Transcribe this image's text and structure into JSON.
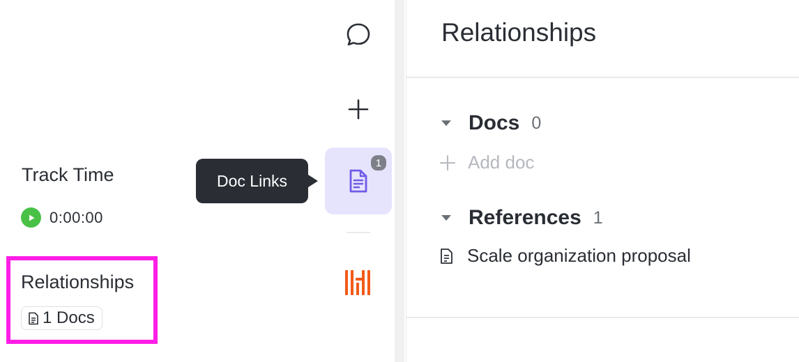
{
  "left_panel": {
    "track_time": {
      "title": "Track Time",
      "value": "0:00:00"
    },
    "relationships": {
      "title": "Relationships",
      "docs_chip": "1 Docs"
    }
  },
  "tooltip": {
    "text": "Doc Links"
  },
  "icon_bar": {
    "items": [
      {
        "icon": "comment-icon"
      },
      {
        "icon": "plus-icon"
      },
      {
        "icon": "document-icon",
        "badge": "1",
        "active": true
      },
      {
        "icon": "brand-logo-icon"
      }
    ]
  },
  "panel": {
    "title": "Relationships",
    "sections": [
      {
        "label": "Docs",
        "count": "0",
        "add_label": "Add doc"
      },
      {
        "label": "References",
        "count": "1",
        "items": [
          "Scale organization proposal"
        ]
      }
    ]
  },
  "colors": {
    "highlight": "#ff1ee6",
    "active_bg": "#e6e3fd",
    "accent": "#6f5ce6",
    "play": "#48c146",
    "brand": "#f25a18"
  }
}
